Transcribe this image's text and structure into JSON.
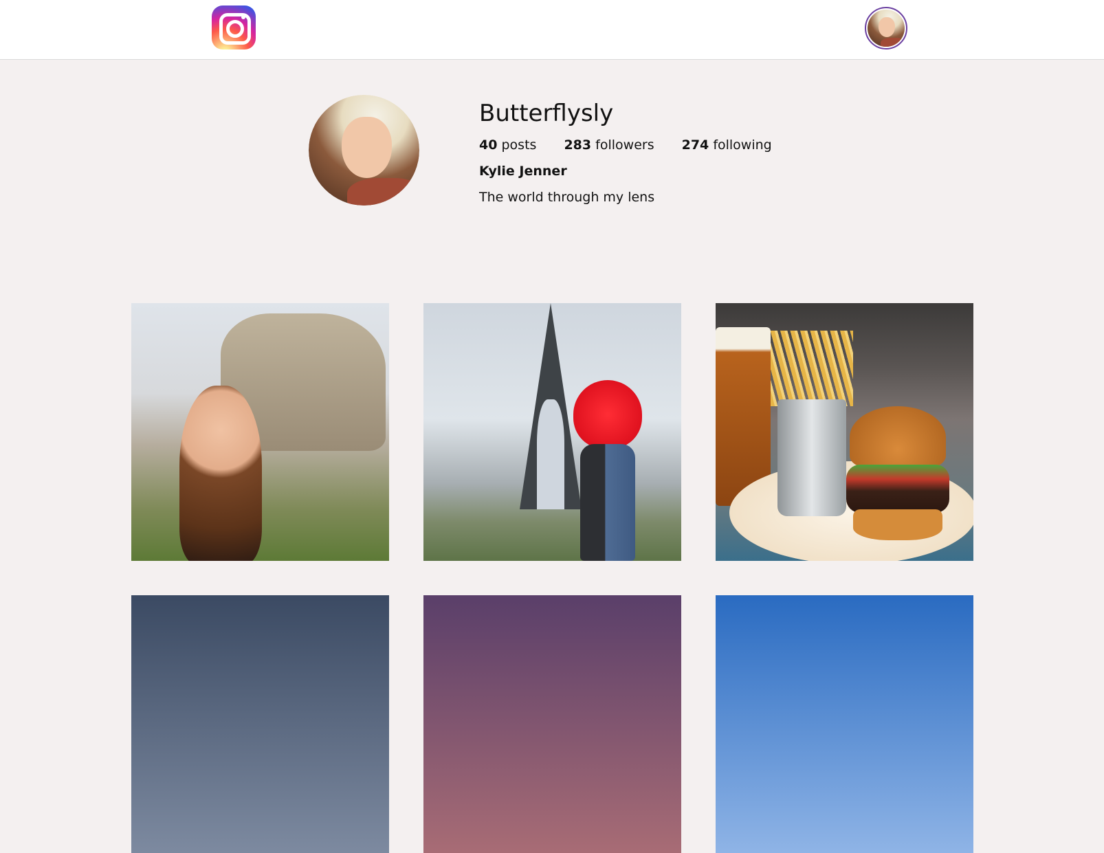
{
  "header": {
    "logo_icon": "instagram-logo-icon",
    "user_avatar": "user-avatar"
  },
  "profile": {
    "username": "Butterflysly",
    "stats": [
      {
        "count": "40",
        "label": "posts"
      },
      {
        "count": "283",
        "label": "followers"
      },
      {
        "count": "274",
        "label": "following"
      }
    ],
    "full_name": "Kylie Jenner",
    "bio": "The world through my lens"
  },
  "posts": [
    {
      "subject": "woman in front of stone monument"
    },
    {
      "subject": "couple with red umbrella at Eiffel Tower"
    },
    {
      "subject": "burger, fries and beer"
    },
    {
      "subject": "cloudy sky"
    },
    {
      "subject": "purple sunset"
    },
    {
      "subject": "blue sky"
    }
  ],
  "colors": {
    "background": "#f4f0f0",
    "topbar": "#ffffff",
    "avatar_ring": "#6a3fa0"
  }
}
